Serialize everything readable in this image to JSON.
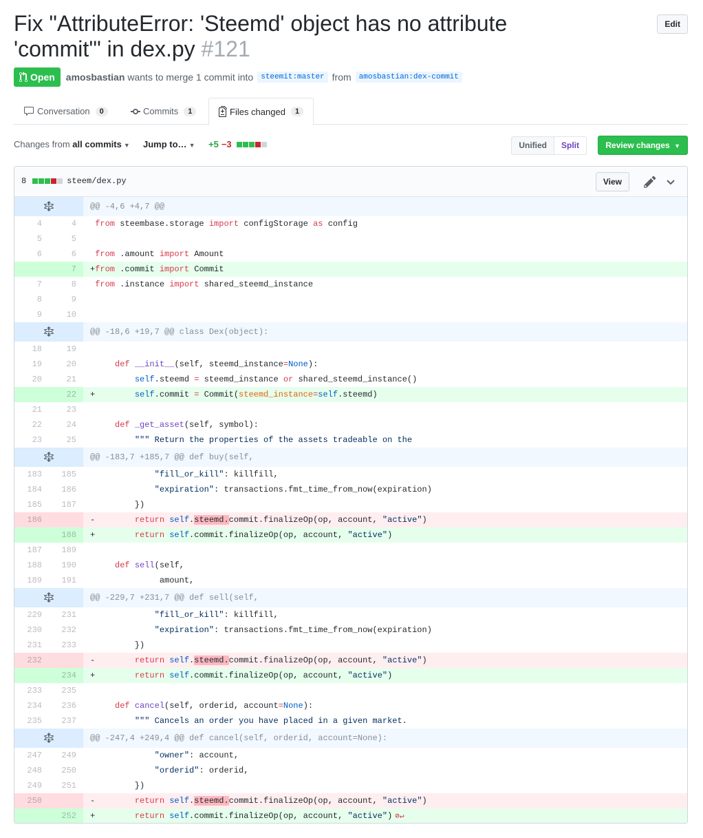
{
  "pr": {
    "title": "Fix \"AttributeError: 'Steemd' object has no attribute 'commit'\" in dex.py",
    "number": "#121",
    "edit_label": "Edit",
    "state": "Open",
    "author": "amosbastian",
    "merge_text": "wants to merge 1 commit into",
    "base_branch": "steemit:master",
    "from_text": "from",
    "head_branch": "amosbastian:dex-commit"
  },
  "tabs": [
    {
      "label": "Conversation",
      "count": "0"
    },
    {
      "label": "Commits",
      "count": "1"
    },
    {
      "label": "Files changed",
      "count": "1"
    }
  ],
  "toolbar": {
    "changes_prefix": "Changes from",
    "changes_value": "all commits",
    "jump_label": "Jump to…",
    "additions": "+5",
    "deletions": "−3",
    "unified_label": "Unified",
    "split_label": "Split",
    "review_label": "Review changes"
  },
  "file": {
    "changes": "8",
    "path": "steem/dex.py",
    "view_label": "View"
  },
  "colors": {
    "added_bg": "#e6ffed",
    "deleted_bg": "#ffeef0",
    "hunk_bg": "#f1f8ff",
    "open_green": "#2cbe4e"
  },
  "diff": [
    {
      "type": "hunk",
      "text": "@@ -4,6 +4,7 @@"
    },
    {
      "type": "ctx",
      "old": "4",
      "new": "4",
      "html": " <span class=\"kw\">from</span> steembase.storage <span class=\"kw\">import</span> configStorage <span class=\"kw\">as</span> config"
    },
    {
      "type": "ctx",
      "old": "5",
      "new": "5",
      "html": ""
    },
    {
      "type": "ctx",
      "old": "6",
      "new": "6",
      "html": " <span class=\"kw\">from</span> .amount <span class=\"kw\">import</span> Amount"
    },
    {
      "type": "add",
      "old": "",
      "new": "7",
      "html": "+<span class=\"kw\">from</span> .commit <span class=\"kw\">import</span> Commit"
    },
    {
      "type": "ctx",
      "old": "7",
      "new": "8",
      "html": " <span class=\"kw\">from</span> .instance <span class=\"kw\">import</span> shared_steemd_instance"
    },
    {
      "type": "ctx",
      "old": "8",
      "new": "9",
      "html": ""
    },
    {
      "type": "ctx",
      "old": "9",
      "new": "10",
      "html": ""
    },
    {
      "type": "hunk",
      "text": "@@ -18,6 +19,7 @@ class Dex(object):"
    },
    {
      "type": "ctx",
      "old": "18",
      "new": "19",
      "html": ""
    },
    {
      "type": "ctx",
      "old": "19",
      "new": "20",
      "html": "     <span class=\"kw\">def</span> <span class=\"fn\">__init__</span>(self, steemd_instance<span class=\"kw\">=</span><span class=\"self\">None</span>):"
    },
    {
      "type": "ctx",
      "old": "20",
      "new": "21",
      "html": "         <span class=\"self\">self</span>.steemd <span class=\"kw\">=</span> steemd_instance <span class=\"kw\">or</span> shared_steemd_instance()"
    },
    {
      "type": "add",
      "old": "",
      "new": "22",
      "html": "+        <span class=\"self\">self</span>.commit <span class=\"kw\">=</span> Commit(<span class=\"param\">steemd_instance</span><span class=\"kw\">=</span><span class=\"self\">self</span>.steemd)"
    },
    {
      "type": "ctx",
      "old": "21",
      "new": "23",
      "html": ""
    },
    {
      "type": "ctx",
      "old": "22",
      "new": "24",
      "html": "     <span class=\"kw\">def</span> <span class=\"fn\">_get_asset</span>(self, symbol):"
    },
    {
      "type": "ctx",
      "old": "23",
      "new": "25",
      "html": "         <span class=\"str\">\"\"\" Return the properties of the assets tradeable on the</span>"
    },
    {
      "type": "hunk",
      "text": "@@ -183,7 +185,7 @@ def buy(self,"
    },
    {
      "type": "ctx",
      "old": "183",
      "new": "185",
      "html": "             <span class=\"str\">\"fill_or_kill\"</span>: killfill,"
    },
    {
      "type": "ctx",
      "old": "184",
      "new": "186",
      "html": "             <span class=\"str\">\"expiration\"</span>: transactions.fmt_time_from_now(expiration)"
    },
    {
      "type": "ctx",
      "old": "185",
      "new": "187",
      "html": "         })"
    },
    {
      "type": "del",
      "old": "186",
      "new": "",
      "html": "-        <span class=\"kw\">return</span> <span class=\"self\">self</span>.<span class=\"hl\">steemd.</span>commit.finalizeOp(op, account, <span class=\"str\">\"active\"</span>)"
    },
    {
      "type": "add",
      "old": "",
      "new": "188",
      "html": "+        <span class=\"kw\">return</span> <span class=\"self\">self</span>.commit.finalizeOp(op, account, <span class=\"str\">\"active\"</span>)"
    },
    {
      "type": "ctx",
      "old": "187",
      "new": "189",
      "html": ""
    },
    {
      "type": "ctx",
      "old": "188",
      "new": "190",
      "html": "     <span class=\"kw\">def</span> <span class=\"fn\">sell</span>(self,"
    },
    {
      "type": "ctx",
      "old": "189",
      "new": "191",
      "html": "              amount,"
    },
    {
      "type": "hunk",
      "text": "@@ -229,7 +231,7 @@ def sell(self,"
    },
    {
      "type": "ctx",
      "old": "229",
      "new": "231",
      "html": "             <span class=\"str\">\"fill_or_kill\"</span>: killfill,"
    },
    {
      "type": "ctx",
      "old": "230",
      "new": "232",
      "html": "             <span class=\"str\">\"expiration\"</span>: transactions.fmt_time_from_now(expiration)"
    },
    {
      "type": "ctx",
      "old": "231",
      "new": "233",
      "html": "         })"
    },
    {
      "type": "del",
      "old": "232",
      "new": "",
      "html": "-        <span class=\"kw\">return</span> <span class=\"self\">self</span>.<span class=\"hl\">steemd.</span>commit.finalizeOp(op, account, <span class=\"str\">\"active\"</span>)"
    },
    {
      "type": "add",
      "old": "",
      "new": "234",
      "html": "+        <span class=\"kw\">return</span> <span class=\"self\">self</span>.commit.finalizeOp(op, account, <span class=\"str\">\"active\"</span>)"
    },
    {
      "type": "ctx",
      "old": "233",
      "new": "235",
      "html": ""
    },
    {
      "type": "ctx",
      "old": "234",
      "new": "236",
      "html": "     <span class=\"kw\">def</span> <span class=\"fn\">cancel</span>(self, orderid, account<span class=\"kw\">=</span><span class=\"self\">None</span>):"
    },
    {
      "type": "ctx",
      "old": "235",
      "new": "237",
      "html": "         <span class=\"str\">\"\"\" Cancels an order you have placed in a given market.</span>"
    },
    {
      "type": "hunk",
      "text": "@@ -247,4 +249,4 @@ def cancel(self, orderid, account=None):"
    },
    {
      "type": "ctx",
      "old": "247",
      "new": "249",
      "html": "             <span class=\"str\">\"owner\"</span>: account,"
    },
    {
      "type": "ctx",
      "old": "248",
      "new": "250",
      "html": "             <span class=\"str\">\"orderid\"</span>: orderid,"
    },
    {
      "type": "ctx",
      "old": "249",
      "new": "251",
      "html": "         })"
    },
    {
      "type": "del",
      "old": "250",
      "new": "",
      "html": "-        <span class=\"kw\">return</span> <span class=\"self\">self</span>.<span class=\"hl\">steemd.</span>commit.finalizeOp(op, account, <span class=\"str\">\"active\"</span>)"
    },
    {
      "type": "add",
      "old": "",
      "new": "252",
      "html": "+        <span class=\"kw\">return</span> <span class=\"self\">self</span>.commit.finalizeOp(op, account, <span class=\"str\">\"active\"</span>)<span class=\"noeol\">⊘↵</span>"
    }
  ]
}
